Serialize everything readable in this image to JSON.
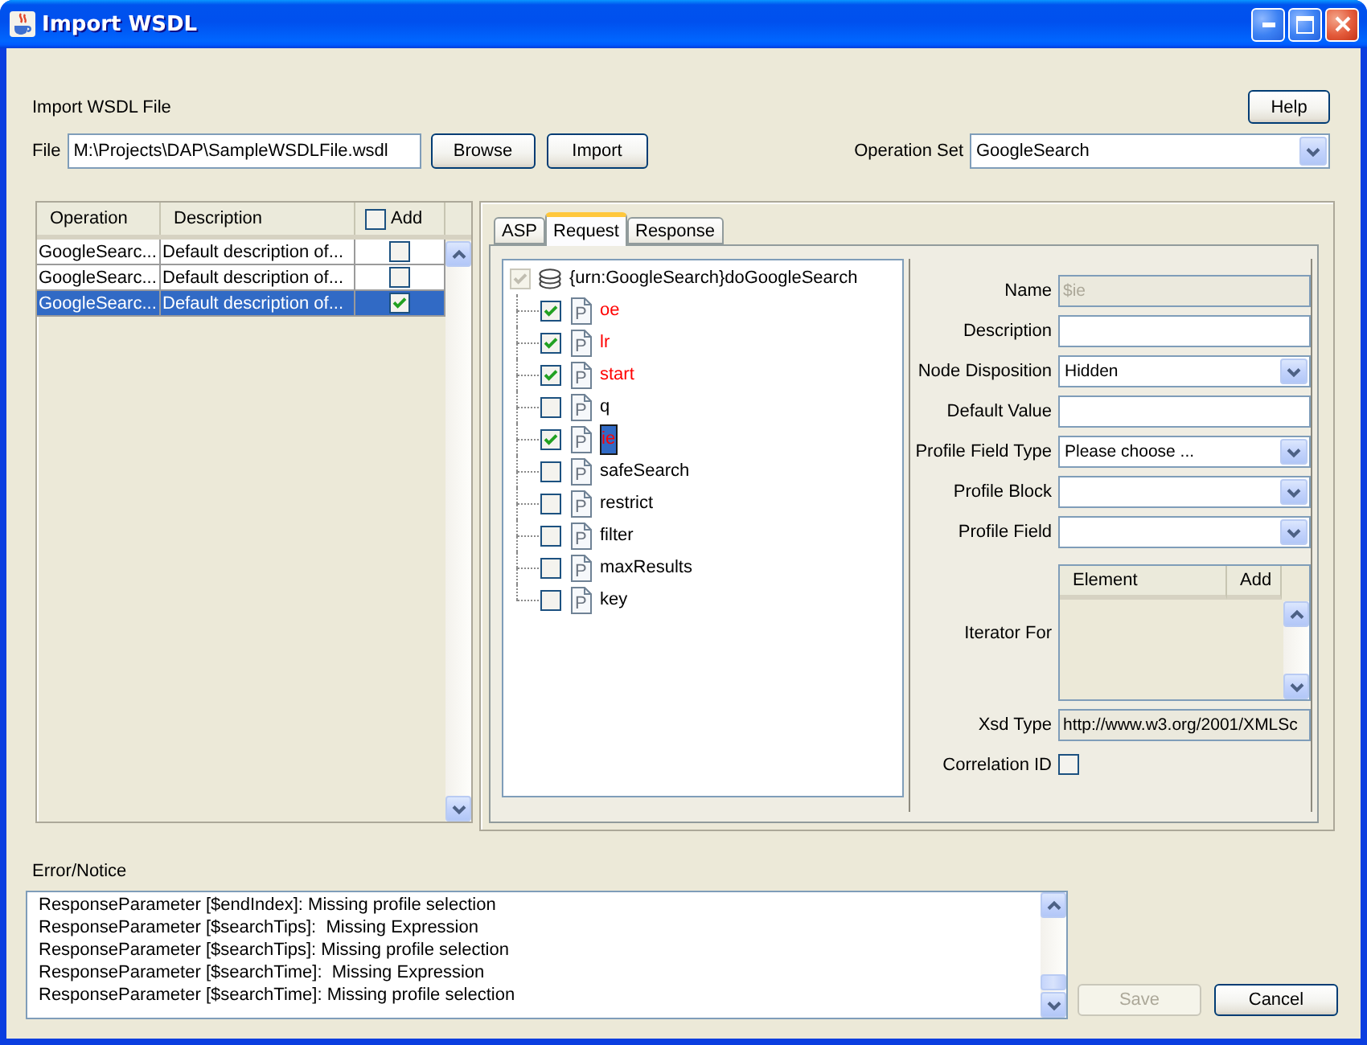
{
  "window": {
    "title": "Import WSDL"
  },
  "import": {
    "heading": "Import WSDL File",
    "help_button": "Help",
    "file_label": "File",
    "file_path": "M:\\Projects\\DAP\\SampleWSDLFile.wsdl",
    "browse_button": "Browse",
    "import_button": "Import",
    "operation_set_label": "Operation Set",
    "operation_set": "GoogleSearch"
  },
  "operations": {
    "columns": [
      {
        "label": "Operation",
        "kind": "text"
      },
      {
        "label": "Description",
        "kind": "text"
      },
      {
        "label": "Add",
        "kind": "checkbox",
        "checked": false
      }
    ],
    "rows": [
      {
        "operation": "GoogleSearc...",
        "description": "Default description of...",
        "add": false,
        "selected": false
      },
      {
        "operation": "GoogleSearc...",
        "description": "Default description of...",
        "add": false,
        "selected": false
      },
      {
        "operation": "GoogleSearc...",
        "description": "Default description of...",
        "add": true,
        "selected": true
      }
    ]
  },
  "tabs": [
    {
      "label": "ASP",
      "selected": false
    },
    {
      "label": "Request",
      "selected": true
    },
    {
      "label": "Response",
      "selected": false
    }
  ],
  "request_tree": {
    "label": "{urn:GoogleSearch}doGoogleSearch",
    "checked": true,
    "disabled": true,
    "selected": false,
    "children": [
      {
        "label": "oe",
        "badge": "P",
        "checked": true,
        "error": true,
        "selected": false
      },
      {
        "label": "lr",
        "badge": "P",
        "checked": true,
        "error": true,
        "selected": false
      },
      {
        "label": "start",
        "badge": "P",
        "checked": true,
        "error": true,
        "selected": false
      },
      {
        "label": "q",
        "badge": "P",
        "checked": false,
        "error": false,
        "selected": false
      },
      {
        "label": "ie",
        "badge": "P",
        "checked": true,
        "error": true,
        "selected": true
      },
      {
        "label": "safeSearch",
        "badge": "P",
        "checked": false,
        "error": false,
        "selected": false
      },
      {
        "label": "restrict",
        "badge": "P",
        "checked": false,
        "error": false,
        "selected": false
      },
      {
        "label": "filter",
        "badge": "P",
        "checked": false,
        "error": false,
        "selected": false
      },
      {
        "label": "maxResults",
        "badge": "P",
        "checked": false,
        "error": false,
        "selected": false
      },
      {
        "label": "key",
        "badge": "P",
        "checked": false,
        "error": false,
        "selected": false
      }
    ]
  },
  "properties": [
    {
      "kind": "text",
      "label": "Name",
      "value": "$ie",
      "disabled": true,
      "editable": false
    },
    {
      "kind": "text",
      "label": "Description",
      "disabled": false,
      "editable": true
    },
    {
      "kind": "combo",
      "label": "Node Disposition",
      "value": "Hidden"
    },
    {
      "kind": "text",
      "label": "Default Value",
      "disabled": false,
      "editable": true
    },
    {
      "kind": "combo",
      "label": "Profile Field Type",
      "value": "Please choose ..."
    },
    {
      "kind": "combo",
      "label": "Profile Block"
    },
    {
      "kind": "combo",
      "label": "Profile Field"
    },
    {
      "kind": "table",
      "label": "Iterator For",
      "columns": [
        "Element",
        "Add"
      ]
    },
    {
      "kind": "text",
      "label": "Xsd Type",
      "value": "http://www.w3.org/2001/XMLSc",
      "disabled": false,
      "editable": false
    },
    {
      "kind": "checkbox",
      "label": "Correlation ID",
      "checked": false
    }
  ],
  "notices": {
    "label": "Error/Notice",
    "lines": [
      "ResponseParameter [$endIndex]: Missing profile selection",
      "ResponseParameter [$searchTips]:  Missing Expression",
      "ResponseParameter [$searchTips]: Missing profile selection",
      "ResponseParameter [$searchTime]:  Missing Expression",
      "ResponseParameter [$searchTime]: Missing profile selection"
    ]
  },
  "buttons": [
    {
      "label": "Save",
      "disabled": true
    },
    {
      "label": "Cancel",
      "disabled": false
    }
  ]
}
